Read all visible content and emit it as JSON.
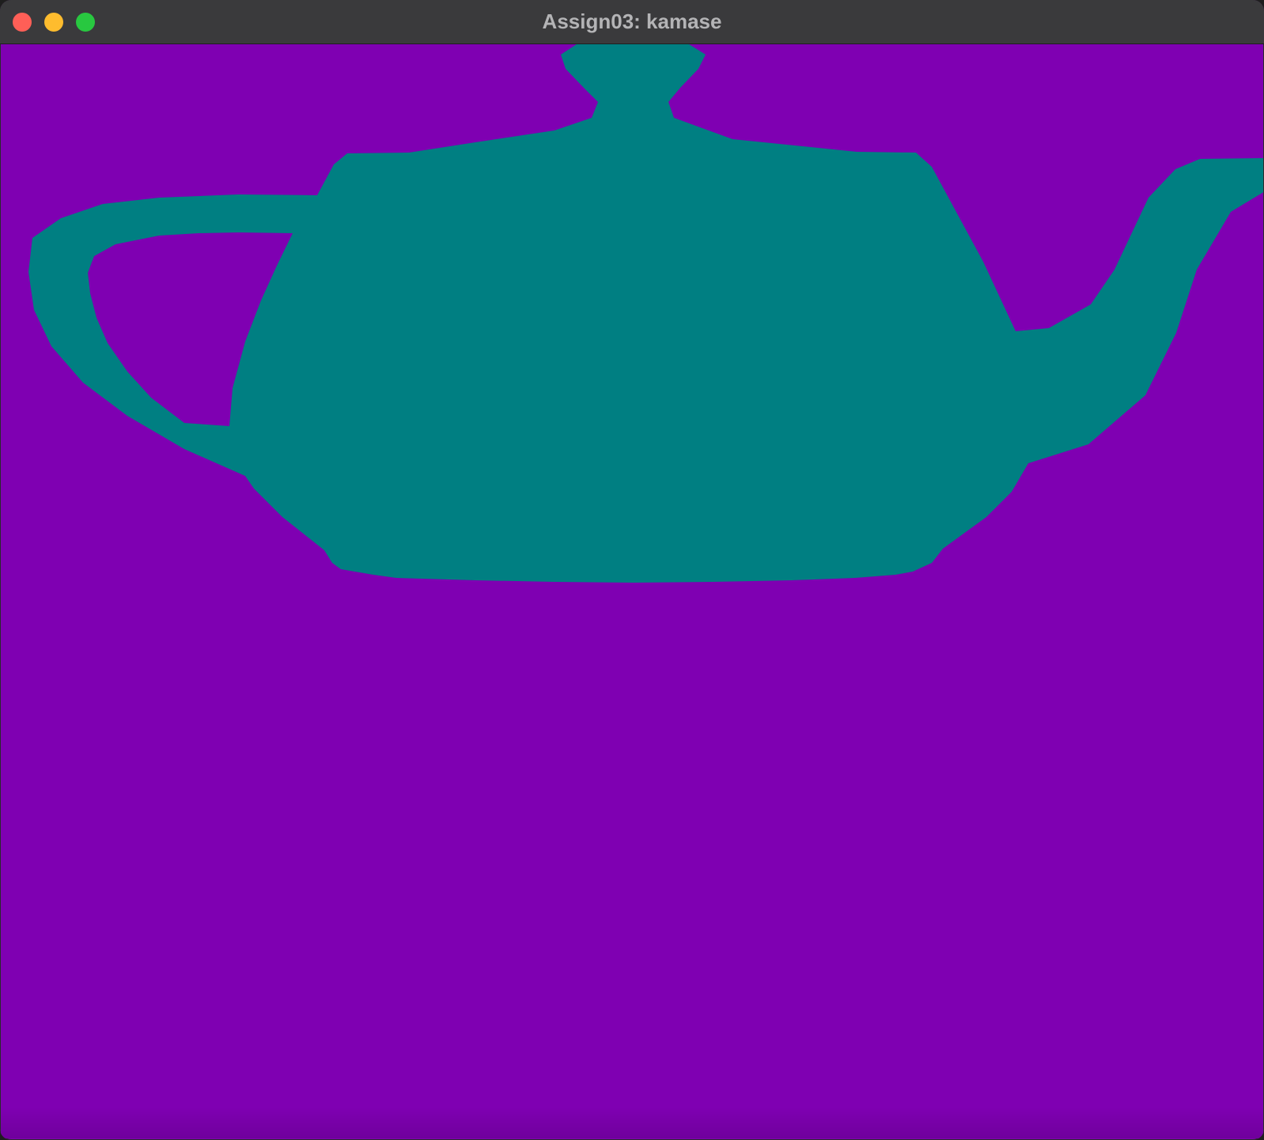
{
  "window": {
    "title": "Assign03: kamase",
    "controls": [
      {
        "name": "close",
        "color": "#ff5f57"
      },
      {
        "name": "minimize",
        "color": "#febc2e"
      },
      {
        "name": "zoom",
        "color": "#28c840"
      }
    ]
  },
  "scene": {
    "background_color": "#7f00b2",
    "object": "teapot",
    "object_color": "#007f82"
  }
}
